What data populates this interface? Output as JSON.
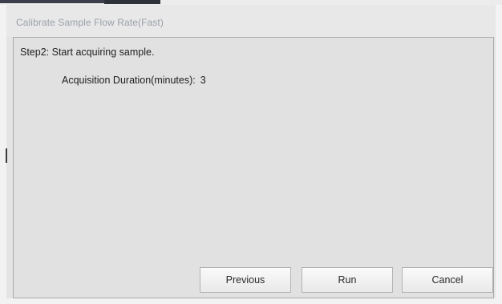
{
  "window": {
    "title": "Calibrate Sample Flow Rate(Fast)"
  },
  "content": {
    "step_text": "Step2: Start acquiring sample.",
    "duration_label": "Acquisition Duration(minutes):",
    "duration_value": "3"
  },
  "buttons": {
    "previous_label": "Previous",
    "run_label": "Run",
    "cancel_label": "Cancel"
  }
}
